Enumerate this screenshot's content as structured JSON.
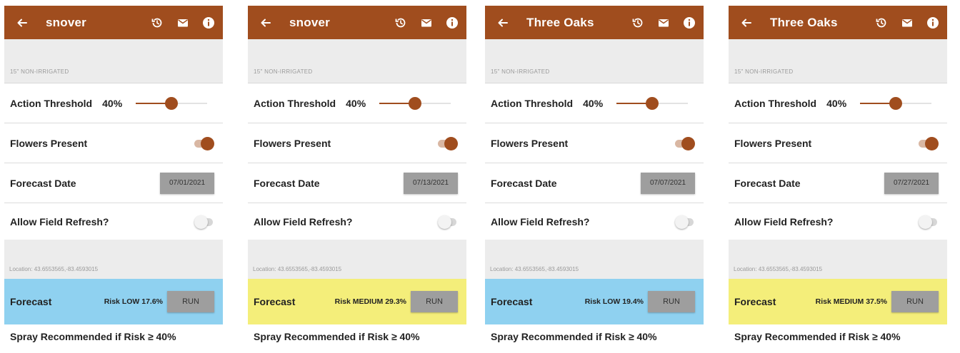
{
  "colors": {
    "brand": "#a04d1e",
    "risk_low": "#8fd1f0",
    "risk_medium": "#f4ee7a"
  },
  "panels": [
    {
      "title": "snover",
      "subheader": "15\" NON-IRRIGATED",
      "action_threshold": {
        "label": "Action Threshold",
        "value": "40%",
        "level": 0.5
      },
      "flowers_present": {
        "label": "Flowers Present",
        "checked": true
      },
      "forecast_date": {
        "label": "Forecast Date",
        "value": "07/01/2021"
      },
      "allow_field_refresh": {
        "label": "Allow Field Refresh?",
        "checked": false
      },
      "location": "Location: 43.6553565,-83.4593015",
      "forecast": {
        "label": "Forecast",
        "risk": "Risk LOW 17.6%",
        "level": "low",
        "run_label": "RUN"
      },
      "spray_text": "Spray Recommended if Risk ≥ 40%",
      "icons": [
        "back-arrow-icon",
        "history-icon",
        "mail-icon",
        "info-icon"
      ]
    },
    {
      "title": "snover",
      "subheader": "15\" NON-IRRIGATED",
      "action_threshold": {
        "label": "Action Threshold",
        "value": "40%",
        "level": 0.5
      },
      "flowers_present": {
        "label": "Flowers Present",
        "checked": true
      },
      "forecast_date": {
        "label": "Forecast Date",
        "value": "07/13/2021"
      },
      "allow_field_refresh": {
        "label": "Allow Field Refresh?",
        "checked": false
      },
      "location": "Location: 43.6553565,-83.4593015",
      "forecast": {
        "label": "Forecast",
        "risk": "Risk MEDIUM 29.3%",
        "level": "medium",
        "run_label": "RUN"
      },
      "spray_text": "Spray Recommended if Risk ≥ 40%",
      "icons": [
        "back-arrow-icon",
        "history-icon",
        "mail-icon",
        "info-icon"
      ]
    },
    {
      "title": "Three Oaks",
      "subheader": "15\" NON-IRRIGATED",
      "action_threshold": {
        "label": "Action Threshold",
        "value": "40%",
        "level": 0.5
      },
      "flowers_present": {
        "label": "Flowers Present",
        "checked": true
      },
      "forecast_date": {
        "label": "Forecast Date",
        "value": "07/07/2021"
      },
      "allow_field_refresh": {
        "label": "Allow Field Refresh?",
        "checked": false
      },
      "location": "Location: 43.6553565,-83.4593015",
      "forecast": {
        "label": "Forecast",
        "risk": "Risk LOW 19.4%",
        "level": "low",
        "run_label": "RUN"
      },
      "spray_text": "Spray Recommended if Risk ≥ 40%",
      "icons": [
        "back-arrow-icon",
        "history-icon",
        "mail-icon",
        "info-icon"
      ]
    },
    {
      "title": "Three Oaks",
      "subheader": "15\" NON-IRRIGATED",
      "action_threshold": {
        "label": "Action Threshold",
        "value": "40%",
        "level": 0.5
      },
      "flowers_present": {
        "label": "Flowers Present",
        "checked": true
      },
      "forecast_date": {
        "label": "Forecast Date",
        "value": "07/27/2021"
      },
      "allow_field_refresh": {
        "label": "Allow Field Refresh?",
        "checked": false
      },
      "location": "Location: 43.6553565,-83.4593015",
      "forecast": {
        "label": "Forecast",
        "risk": "Risk MEDIUM 37.5%",
        "level": "medium",
        "run_label": "RUN"
      },
      "spray_text": "Spray Recommended if Risk ≥ 40%",
      "icons": [
        "back-arrow-icon",
        "history-icon",
        "mail-icon",
        "info-icon"
      ]
    }
  ]
}
